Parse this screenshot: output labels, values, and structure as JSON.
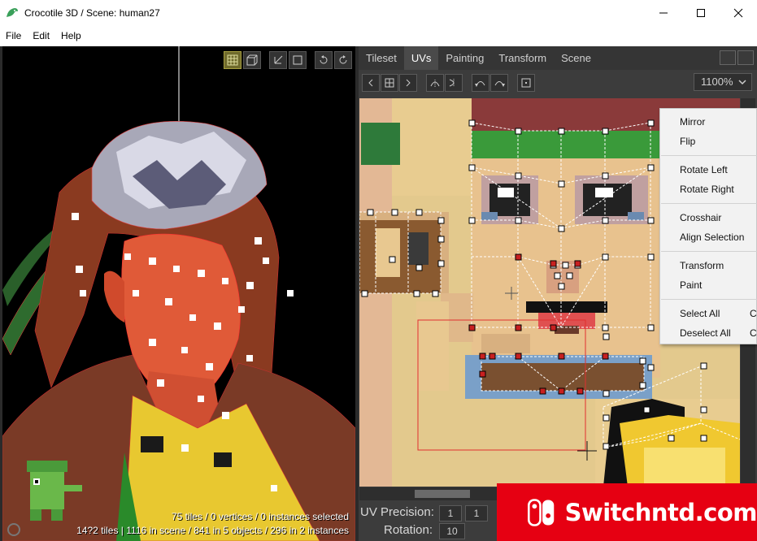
{
  "window": {
    "title": "Crocotile 3D / Scene: human27"
  },
  "menu": [
    "File",
    "Edit",
    "Help"
  ],
  "viewport": {
    "stats_line1": "75 tiles / 0 vertices / 0 instances selected",
    "stats_line2": "14?2 tiles | 1116 in scene / 841 in 5 objects / 296 in 2 instances"
  },
  "panel": {
    "tabs": [
      "Tileset",
      "UVs",
      "Painting",
      "Transform",
      "Scene"
    ],
    "active_tab": "UVs",
    "zoom": "1100%"
  },
  "context_menu": {
    "items": [
      "Mirror",
      "Flip",
      "Rotate Left",
      "Rotate Right",
      "Crosshair",
      "Align Selection",
      "Transform",
      "Paint",
      "Select All",
      "Deselect All"
    ],
    "shortcuts": [
      "C",
      "C"
    ]
  },
  "uv_fields": {
    "precision_label": "UV Precision:",
    "precision_x": "1",
    "precision_y": "1",
    "rotation_label": "Rotation:",
    "rotation": "10"
  },
  "watermark": {
    "text": "Switchntd.com"
  },
  "colors": {
    "accent_selection": "#e03030",
    "watermark": "#e60012"
  }
}
